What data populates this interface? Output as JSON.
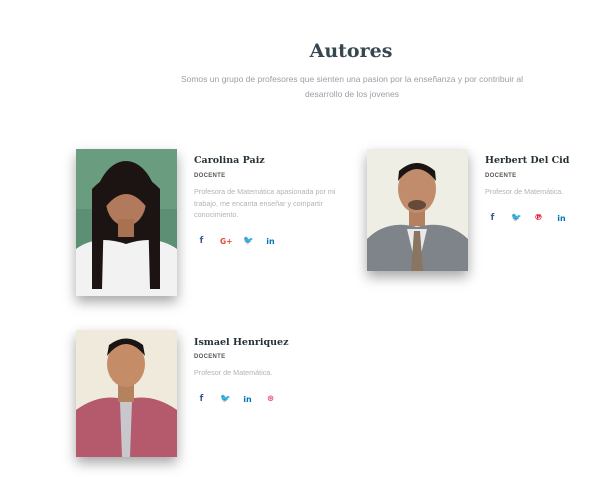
{
  "header": {
    "title": "Autores",
    "subtitle": "Somos un grupo de profesores que sienten una pasion por la enseñanza y por contribuir al desarrollo de los jovenes"
  },
  "authors": [
    {
      "name": "Carolina Paiz",
      "role": "DOCENTE",
      "description": "Profesora de Matemática apasionada por mi trabajo, me encanta enseñar y compartir conocimiento.",
      "socials": [
        "facebook-icon",
        "google-plus-icon",
        "twitter-icon",
        "linkedin-icon"
      ]
    },
    {
      "name": "Herbert Del Cid",
      "role": "DOCENTE",
      "description": "Profesor de Matemática.",
      "socials": [
        "facebook-icon",
        "twitter-icon",
        "pinterest-icon",
        "linkedin-icon"
      ]
    },
    {
      "name": "Ismael Henriquez",
      "role": "DOCENTE",
      "description": "Profesor de Matemática.",
      "socials": [
        "facebook-icon",
        "twitter-icon",
        "linkedin-icon",
        "dribbble-icon"
      ]
    }
  ],
  "icon_glyphs": {
    "facebook": "f",
    "google_plus": "G+",
    "twitter": "🐦",
    "linkedin": "in",
    "pinterest": "℗",
    "dribbble": "⊛"
  },
  "colors": {
    "title": "#37474f",
    "facebook": "#3b5998",
    "google_plus": "#dd4b39",
    "twitter": "#1da1f2",
    "linkedin": "#0077b5",
    "pinterest": "#e60023",
    "dribbble": "#ea4c89"
  }
}
